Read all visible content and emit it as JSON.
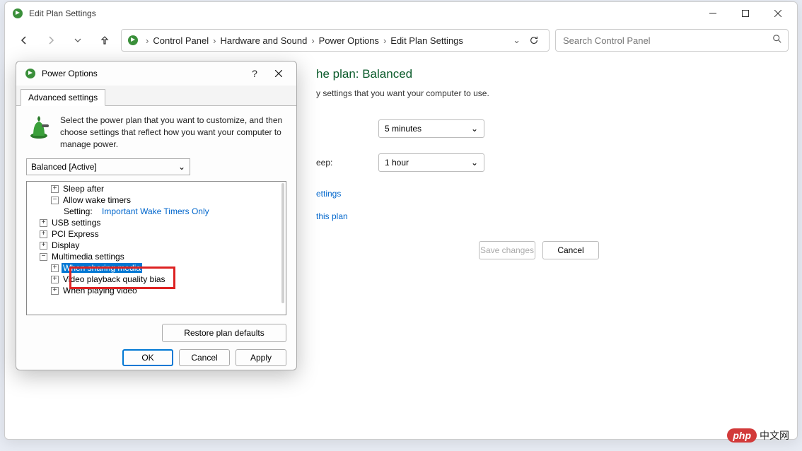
{
  "window": {
    "title": "Edit Plan Settings"
  },
  "breadcrumb": {
    "items": [
      "Control Panel",
      "Hardware and Sound",
      "Power Options",
      "Edit Plan Settings"
    ]
  },
  "search": {
    "placeholder": "Search Control Panel"
  },
  "page": {
    "title_suffix": "he plan: Balanced",
    "subtitle_suffix": "y settings that you want your computer to use.",
    "sleep_label": "eep:",
    "display_value": "5 minutes",
    "sleep_value": "1 hour",
    "link1_suffix": "ettings",
    "link2_suffix": "this plan",
    "save": "Save changes",
    "cancel": "Cancel"
  },
  "dialog": {
    "title": "Power Options",
    "tab": "Advanced settings",
    "description": "Select the power plan that you want to customize, and then choose settings that reflect how you want your computer to manage power.",
    "plan": "Balanced [Active]",
    "tree": {
      "sleep_after": "Sleep after",
      "allow_wake": "Allow wake timers",
      "setting_label": "Setting:",
      "setting_value": "Important Wake Timers Only",
      "usb": "USB settings",
      "pci": "PCI Express",
      "display": "Display",
      "multimedia": "Multimedia settings",
      "sharing": "When sharing media",
      "video_quality": "Video playback quality bias",
      "playing_video": "When playing video"
    },
    "restore": "Restore plan defaults",
    "ok": "OK",
    "cancel": "Cancel",
    "apply": "Apply"
  },
  "watermark": {
    "brand": "php",
    "text": "中文网"
  }
}
